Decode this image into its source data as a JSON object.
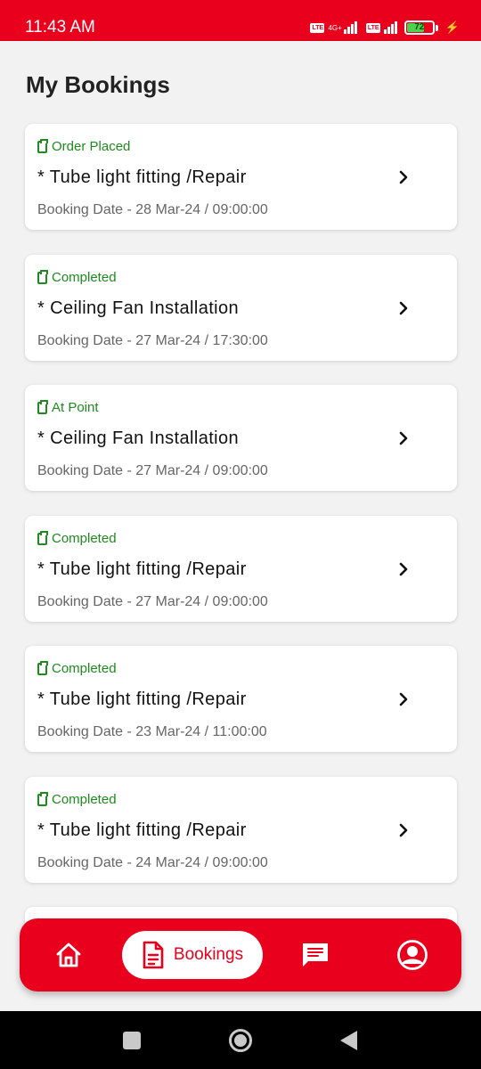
{
  "status_bar": {
    "time": "11:43 AM",
    "network": "4G+",
    "volte": "Vo LTE",
    "battery": "72",
    "battery_level": 0.72
  },
  "page": {
    "title": "My Bookings"
  },
  "colors": {
    "brand": "#e8001c",
    "status_green": "#1f8a1f"
  },
  "bookings": [
    {
      "status": "Order Placed",
      "service": "* Tube light fitting /Repair",
      "date": "Booking Date - 28 Mar-24 / 09:00:00"
    },
    {
      "status": "Completed",
      "service": "* Ceiling Fan Installation",
      "date": "Booking Date - 27 Mar-24 / 17:30:00"
    },
    {
      "status": "At Point",
      "service": "* Ceiling Fan Installation",
      "date": "Booking Date - 27 Mar-24 / 09:00:00"
    },
    {
      "status": "Completed",
      "service": "* Tube light fitting /Repair",
      "date": "Booking Date - 27 Mar-24 / 09:00:00"
    },
    {
      "status": "Completed",
      "service": "* Tube light fitting /Repair",
      "date": "Booking Date - 23 Mar-24 / 11:00:00"
    },
    {
      "status": "Completed",
      "service": "* Tube light fitting /Repair",
      "date": "Booking Date - 24 Mar-24 / 09:00:00"
    }
  ],
  "bottom_nav": {
    "bookings_label": "Bookings",
    "items": [
      "home-icon",
      "document-icon",
      "chat-icon",
      "profile-icon"
    ],
    "active": "Bookings"
  }
}
